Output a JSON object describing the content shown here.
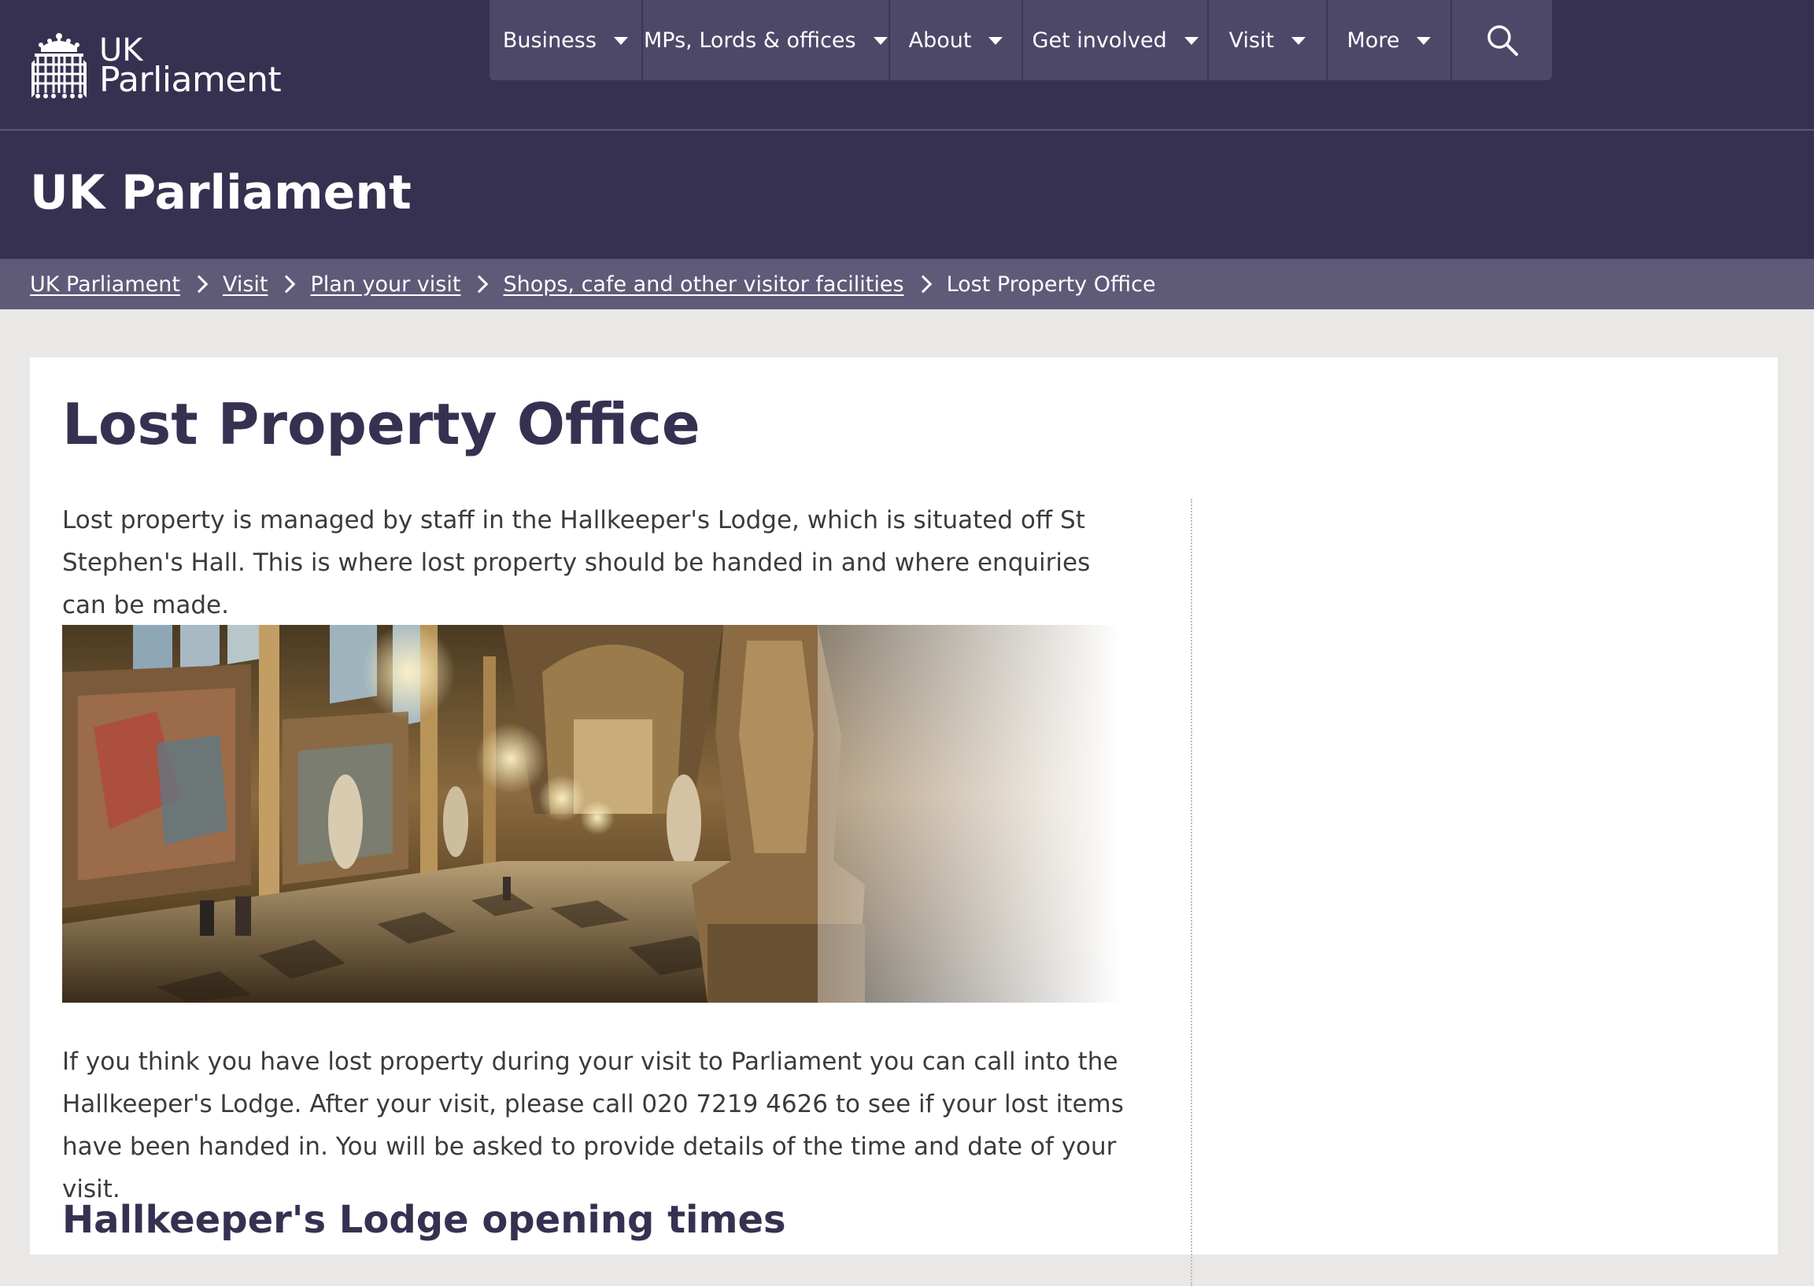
{
  "header": {
    "logo": {
      "line1": "UK",
      "line2": "Parliament"
    },
    "nav": [
      {
        "label": "Business"
      },
      {
        "label": "MPs, Lords & offices"
      },
      {
        "label": "About"
      },
      {
        "label": "Get involved"
      },
      {
        "label": "Visit"
      },
      {
        "label": "More"
      }
    ],
    "search_icon": "search-icon"
  },
  "section": {
    "title": "UK Parliament"
  },
  "breadcrumb": {
    "items": [
      {
        "label": "UK Parliament"
      },
      {
        "label": "Visit"
      },
      {
        "label": "Plan your visit"
      },
      {
        "label": "Shops, cafe and other visitor facilities"
      }
    ],
    "current": "Lost Property Office"
  },
  "main": {
    "title": "Lost Property Office",
    "paragraph1": "Lost property is managed by staff in the Hallkeeper's Lodge, which is situated off St Stephen's Hall.  This is where lost property should be handed in and where enquiries can be made.",
    "paragraph2": "If you think you have lost property during your visit to Parliament you can call into the Hallkeeper's Lodge. After your visit, please call 020 7219 4626 to see if your lost items have been handed in. You will be asked to provide details of the time and date of your visit.",
    "subheading": "Hallkeeper's Lodge opening times"
  },
  "colors": {
    "header_bg": "#373151",
    "nav_bg": "#4d4868",
    "breadcrumb_bg": "#5f5a78",
    "page_bg": "#e9e8e6",
    "heading_text": "#373151"
  }
}
